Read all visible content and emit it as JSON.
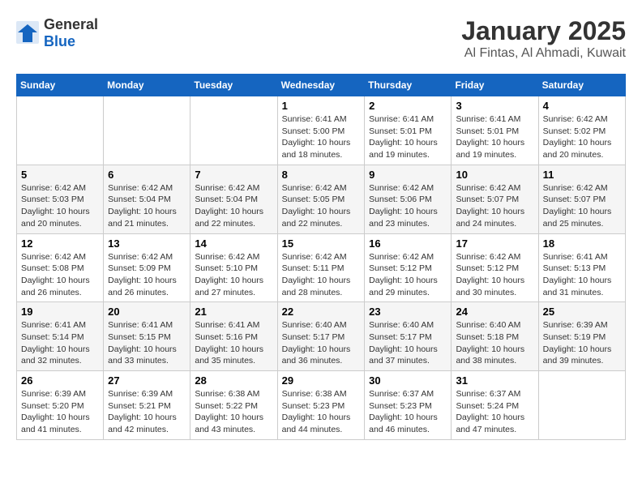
{
  "header": {
    "logo_general": "General",
    "logo_blue": "Blue",
    "month_title": "January 2025",
    "location": "Al Fintas, Al Ahmadi, Kuwait"
  },
  "days_of_week": [
    "Sunday",
    "Monday",
    "Tuesday",
    "Wednesday",
    "Thursday",
    "Friday",
    "Saturday"
  ],
  "weeks": [
    [
      {
        "day": "",
        "info": ""
      },
      {
        "day": "",
        "info": ""
      },
      {
        "day": "",
        "info": ""
      },
      {
        "day": "1",
        "info": "Sunrise: 6:41 AM\nSunset: 5:00 PM\nDaylight: 10 hours and 18 minutes."
      },
      {
        "day": "2",
        "info": "Sunrise: 6:41 AM\nSunset: 5:01 PM\nDaylight: 10 hours and 19 minutes."
      },
      {
        "day": "3",
        "info": "Sunrise: 6:41 AM\nSunset: 5:01 PM\nDaylight: 10 hours and 19 minutes."
      },
      {
        "day": "4",
        "info": "Sunrise: 6:42 AM\nSunset: 5:02 PM\nDaylight: 10 hours and 20 minutes."
      }
    ],
    [
      {
        "day": "5",
        "info": "Sunrise: 6:42 AM\nSunset: 5:03 PM\nDaylight: 10 hours and 20 minutes."
      },
      {
        "day": "6",
        "info": "Sunrise: 6:42 AM\nSunset: 5:04 PM\nDaylight: 10 hours and 21 minutes."
      },
      {
        "day": "7",
        "info": "Sunrise: 6:42 AM\nSunset: 5:04 PM\nDaylight: 10 hours and 22 minutes."
      },
      {
        "day": "8",
        "info": "Sunrise: 6:42 AM\nSunset: 5:05 PM\nDaylight: 10 hours and 22 minutes."
      },
      {
        "day": "9",
        "info": "Sunrise: 6:42 AM\nSunset: 5:06 PM\nDaylight: 10 hours and 23 minutes."
      },
      {
        "day": "10",
        "info": "Sunrise: 6:42 AM\nSunset: 5:07 PM\nDaylight: 10 hours and 24 minutes."
      },
      {
        "day": "11",
        "info": "Sunrise: 6:42 AM\nSunset: 5:07 PM\nDaylight: 10 hours and 25 minutes."
      }
    ],
    [
      {
        "day": "12",
        "info": "Sunrise: 6:42 AM\nSunset: 5:08 PM\nDaylight: 10 hours and 26 minutes."
      },
      {
        "day": "13",
        "info": "Sunrise: 6:42 AM\nSunset: 5:09 PM\nDaylight: 10 hours and 26 minutes."
      },
      {
        "day": "14",
        "info": "Sunrise: 6:42 AM\nSunset: 5:10 PM\nDaylight: 10 hours and 27 minutes."
      },
      {
        "day": "15",
        "info": "Sunrise: 6:42 AM\nSunset: 5:11 PM\nDaylight: 10 hours and 28 minutes."
      },
      {
        "day": "16",
        "info": "Sunrise: 6:42 AM\nSunset: 5:12 PM\nDaylight: 10 hours and 29 minutes."
      },
      {
        "day": "17",
        "info": "Sunrise: 6:42 AM\nSunset: 5:12 PM\nDaylight: 10 hours and 30 minutes."
      },
      {
        "day": "18",
        "info": "Sunrise: 6:41 AM\nSunset: 5:13 PM\nDaylight: 10 hours and 31 minutes."
      }
    ],
    [
      {
        "day": "19",
        "info": "Sunrise: 6:41 AM\nSunset: 5:14 PM\nDaylight: 10 hours and 32 minutes."
      },
      {
        "day": "20",
        "info": "Sunrise: 6:41 AM\nSunset: 5:15 PM\nDaylight: 10 hours and 33 minutes."
      },
      {
        "day": "21",
        "info": "Sunrise: 6:41 AM\nSunset: 5:16 PM\nDaylight: 10 hours and 35 minutes."
      },
      {
        "day": "22",
        "info": "Sunrise: 6:40 AM\nSunset: 5:17 PM\nDaylight: 10 hours and 36 minutes."
      },
      {
        "day": "23",
        "info": "Sunrise: 6:40 AM\nSunset: 5:17 PM\nDaylight: 10 hours and 37 minutes."
      },
      {
        "day": "24",
        "info": "Sunrise: 6:40 AM\nSunset: 5:18 PM\nDaylight: 10 hours and 38 minutes."
      },
      {
        "day": "25",
        "info": "Sunrise: 6:39 AM\nSunset: 5:19 PM\nDaylight: 10 hours and 39 minutes."
      }
    ],
    [
      {
        "day": "26",
        "info": "Sunrise: 6:39 AM\nSunset: 5:20 PM\nDaylight: 10 hours and 41 minutes."
      },
      {
        "day": "27",
        "info": "Sunrise: 6:39 AM\nSunset: 5:21 PM\nDaylight: 10 hours and 42 minutes."
      },
      {
        "day": "28",
        "info": "Sunrise: 6:38 AM\nSunset: 5:22 PM\nDaylight: 10 hours and 43 minutes."
      },
      {
        "day": "29",
        "info": "Sunrise: 6:38 AM\nSunset: 5:23 PM\nDaylight: 10 hours and 44 minutes."
      },
      {
        "day": "30",
        "info": "Sunrise: 6:37 AM\nSunset: 5:23 PM\nDaylight: 10 hours and 46 minutes."
      },
      {
        "day": "31",
        "info": "Sunrise: 6:37 AM\nSunset: 5:24 PM\nDaylight: 10 hours and 47 minutes."
      },
      {
        "day": "",
        "info": ""
      }
    ]
  ]
}
